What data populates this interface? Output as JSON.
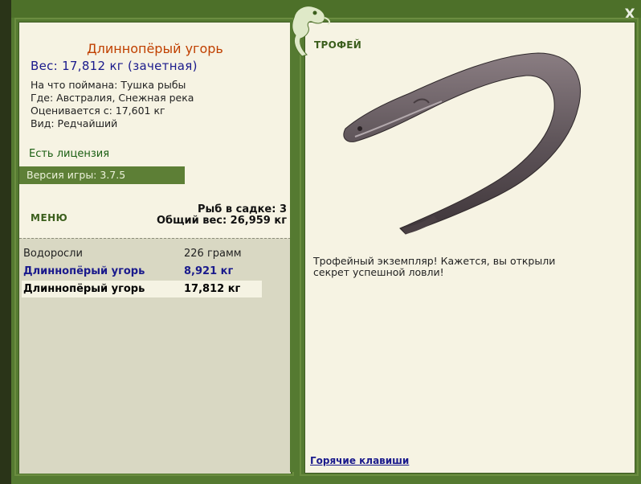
{
  "window": {
    "close_label": "X"
  },
  "fish": {
    "name": "Длиннопёрый угорь",
    "weight_line": "Вес: 17,812 кг (зачетная)",
    "bait_line": "На что поймана: Тушка рыбы",
    "location_line": "Где: Австралия, Снежная река",
    "valued_line": "Оценивается с: 17,601 кг",
    "species_line": "Вид: Редчайший"
  },
  "license": "Есть лицензия",
  "version": "Версия игры: 3.7.5",
  "menu_label": "МЕНЮ",
  "keepnet": {
    "count_line": "Рыб в садке: 3",
    "total_line": "Общий вес: 26,959 кг"
  },
  "catch": [
    {
      "name": "Водоросли",
      "weight": "226 грамм"
    },
    {
      "name": "Длиннопёрый угорь",
      "weight": "8,921 кг"
    },
    {
      "name": "Длиннопёрый угорь",
      "weight": "17,812 кг"
    }
  ],
  "trophy": {
    "label": "ТРОФЕЙ",
    "text": "Трофейный экземпляр! Кажется, вы открыли секрет успешной ловли!"
  },
  "hotkeys_label": "Горячие клавиши",
  "colors": {
    "frame": "#557a31",
    "panel": "#f6f3e3",
    "fish_name": "#c04000",
    "weight": "#1a1a8c",
    "list_bg": "#d9d8c3"
  },
  "icons": [
    "chameleon-logo-icon",
    "eel-image"
  ]
}
